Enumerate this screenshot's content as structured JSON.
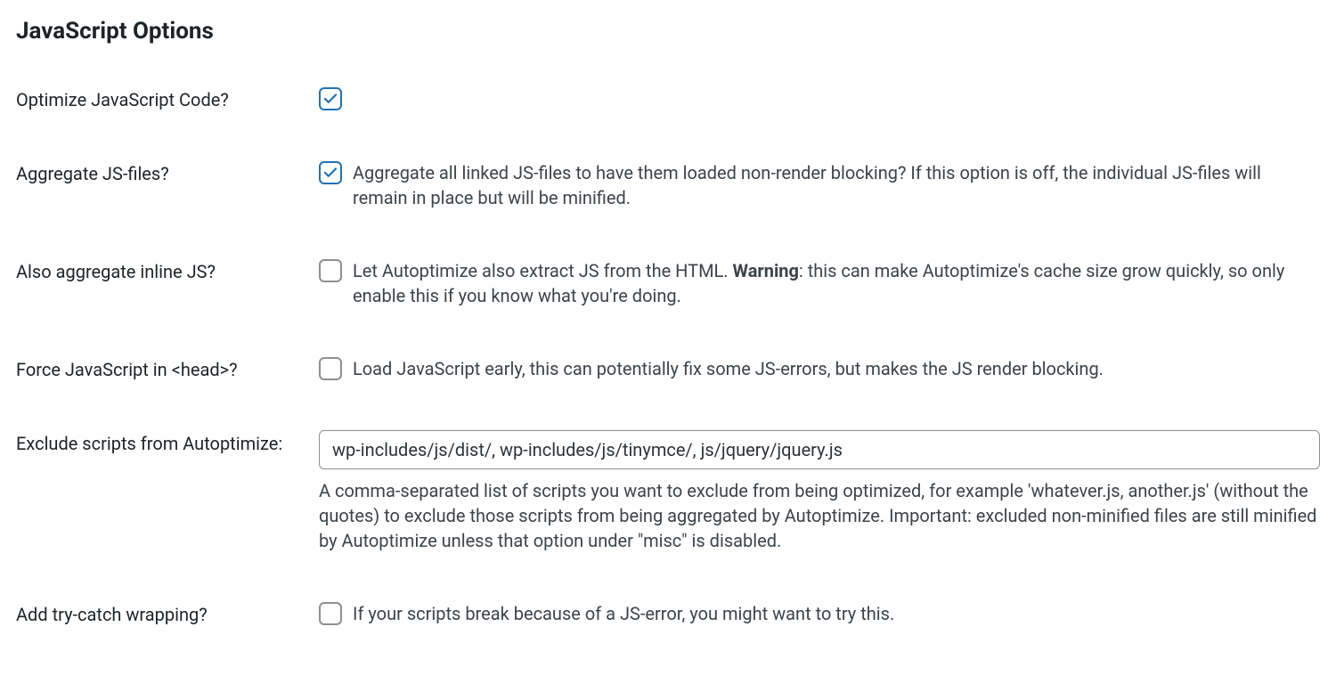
{
  "section": {
    "title": "JavaScript Options"
  },
  "options": {
    "optimize": {
      "label": "Optimize JavaScript Code?",
      "checked": true,
      "desc": ""
    },
    "aggregate": {
      "label": "Aggregate JS-files?",
      "checked": true,
      "desc": "Aggregate all linked JS-files to have them loaded non-render blocking? If this option is off, the individual JS-files will remain in place but will be minified."
    },
    "inline": {
      "label": "Also aggregate inline JS?",
      "checked": false,
      "desc_prefix": "Let Autoptimize also extract JS from the HTML. ",
      "desc_warning": "Warning",
      "desc_suffix": ": this can make Autoptimize's cache size grow quickly, so only enable this if you know what you're doing."
    },
    "force_head": {
      "label": "Force JavaScript in <head>?",
      "checked": false,
      "desc": "Load JavaScript early, this can potentially fix some JS-errors, but makes the JS render blocking."
    },
    "exclude": {
      "label": "Exclude scripts from Autoptimize:",
      "value": "wp-includes/js/dist/, wp-includes/js/tinymce/, js/jquery/jquery.js",
      "desc": "A comma-separated list of scripts you want to exclude from being optimized, for example 'whatever.js, another.js' (without the quotes) to exclude those scripts from being aggregated by Autoptimize. Important: excluded non-minified files are still minified by Autoptimize unless that option under \"misc\" is disabled."
    },
    "trycatch": {
      "label": "Add try-catch wrapping?",
      "checked": false,
      "desc": "If your scripts break because of a JS-error, you might want to try this."
    }
  }
}
